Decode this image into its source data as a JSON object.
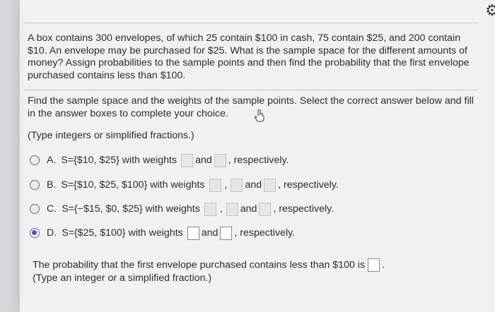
{
  "question": {
    "text": "A box contains 300 envelopes, of which 25 contain $100 in cash, 75 contain $25, and 200 contain $10. An envelope may be purchased for $25. What is the sample space for the different amounts of money? Assign probabilities to the sample points and then find the probability that the first envelope purchased contains less than $100."
  },
  "part1": {
    "prompt": "Find the sample space and the weights of the sample points. Select the correct answer below and fill in the answer boxes to complete your choice.",
    "hint": "(Type integers or simplified fractions.)",
    "options": [
      {
        "letter": "A.",
        "set": "S={$10, $25} with weights",
        "and": "and",
        "tail": ", respectively."
      },
      {
        "letter": "B.",
        "set": "S={$10, $25, $100} with weights",
        "and": "and",
        "tail": ", respectively."
      },
      {
        "letter": "C.",
        "set": "S={−$15, $0, $25} with weights",
        "and": "and",
        "tail": ", respectively."
      },
      {
        "letter": "D.",
        "set": "S={$25, $100} with weights",
        "and": "and",
        "tail": ", respectively."
      }
    ],
    "selected": "D."
  },
  "part2": {
    "prompt": "The probability that the first envelope purchased contains less than $100 is",
    "end": ".",
    "hint": "(Type an integer or a simplified fraction.)"
  },
  "icons": {
    "settings": "gear-icon",
    "pointer": "hand-cursor-icon"
  },
  "colors": {
    "selected_radio": "#6b45c2"
  }
}
